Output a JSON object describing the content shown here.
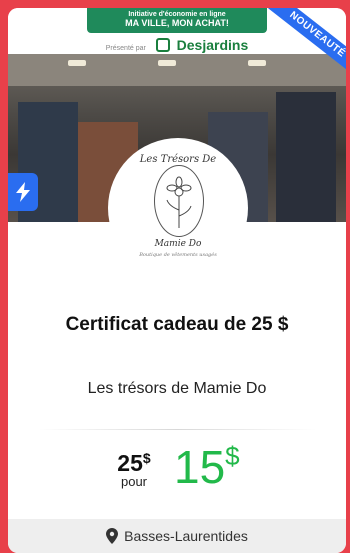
{
  "banner": {
    "line1": "Initiative d'économie en ligne",
    "line2": "MA VILLE, MON ACHAT!",
    "presented_by": "Présenté par",
    "sponsor": "Desjardins"
  },
  "ribbon": {
    "label": "NOUVEAUTÉ"
  },
  "logo": {
    "top_text": "Les Trésors De",
    "bottom_text": "Mamie Do",
    "tagline": "Boutique de vêtements usagés"
  },
  "offer": {
    "title": "Certificat cadeau de 25 $",
    "merchant": "Les trésors de Mamie Do",
    "original_value": "25",
    "original_currency": "$",
    "pour_label": "pour",
    "deal_price": "15",
    "deal_currency": "$"
  },
  "location": {
    "region": "Basses-Laurentides"
  },
  "colors": {
    "page_background": "#e8404a",
    "accent_blue": "#2a6df0",
    "price_green": "#22b94a",
    "banner_green": "#1f8a5b"
  },
  "icons": {
    "flash": "lightning-icon",
    "location": "map-pin-icon",
    "sponsor": "desjardins-logo-icon"
  }
}
